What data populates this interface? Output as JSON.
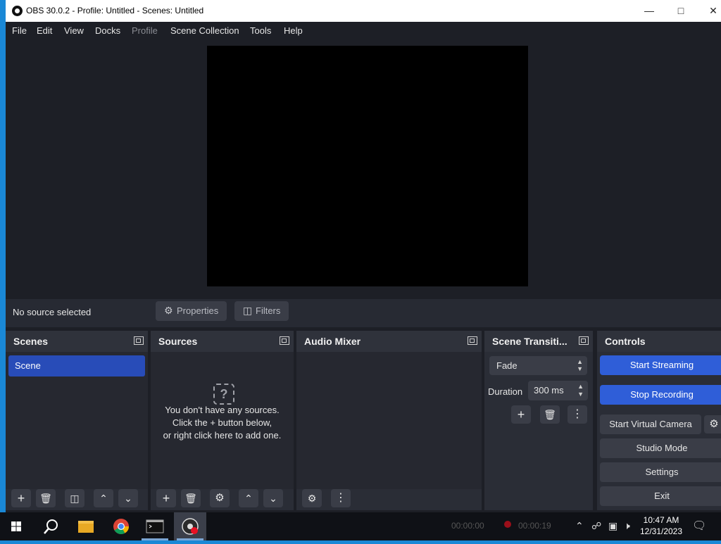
{
  "window": {
    "title": "OBS 30.0.2 - Profile: Untitled - Scenes: Untitled"
  },
  "menu": [
    "File",
    "Edit",
    "View",
    "Docks",
    "Profile",
    "Scene Collection",
    "Tools",
    "Help"
  ],
  "status": {
    "no_source": "No source selected",
    "properties_label": "Properties",
    "filters_label": "Filters"
  },
  "docks": {
    "scenes": {
      "title": "Scenes",
      "items": [
        "Scene"
      ]
    },
    "sources": {
      "title": "Sources",
      "empty_line1": "You don't have any sources.",
      "empty_line2": "Click the + button below,",
      "empty_line3": "or right click here to add one."
    },
    "audio_mixer": {
      "title": "Audio Mixer"
    },
    "transitions": {
      "title": "Scene Transiti...",
      "selected": "Fade",
      "duration_label": "Duration",
      "duration_value": "300 ms"
    },
    "controls": {
      "title": "Controls",
      "start_streaming": "Start Streaming",
      "stop_recording": "Stop Recording",
      "virtual_camera": "Start Virtual Camera",
      "studio_mode": "Studio Mode",
      "settings": "Settings",
      "exit": "Exit"
    }
  },
  "taskbar": {
    "time": "10:47 AM",
    "date": "12/31/2023",
    "stats": {
      "stream_time": "00:00:00",
      "rec_time": "00:00:19"
    }
  },
  "colors": {
    "accent": "#2f5ed8",
    "scene_selected": "#284cb8",
    "bg": "#1d1f26"
  }
}
